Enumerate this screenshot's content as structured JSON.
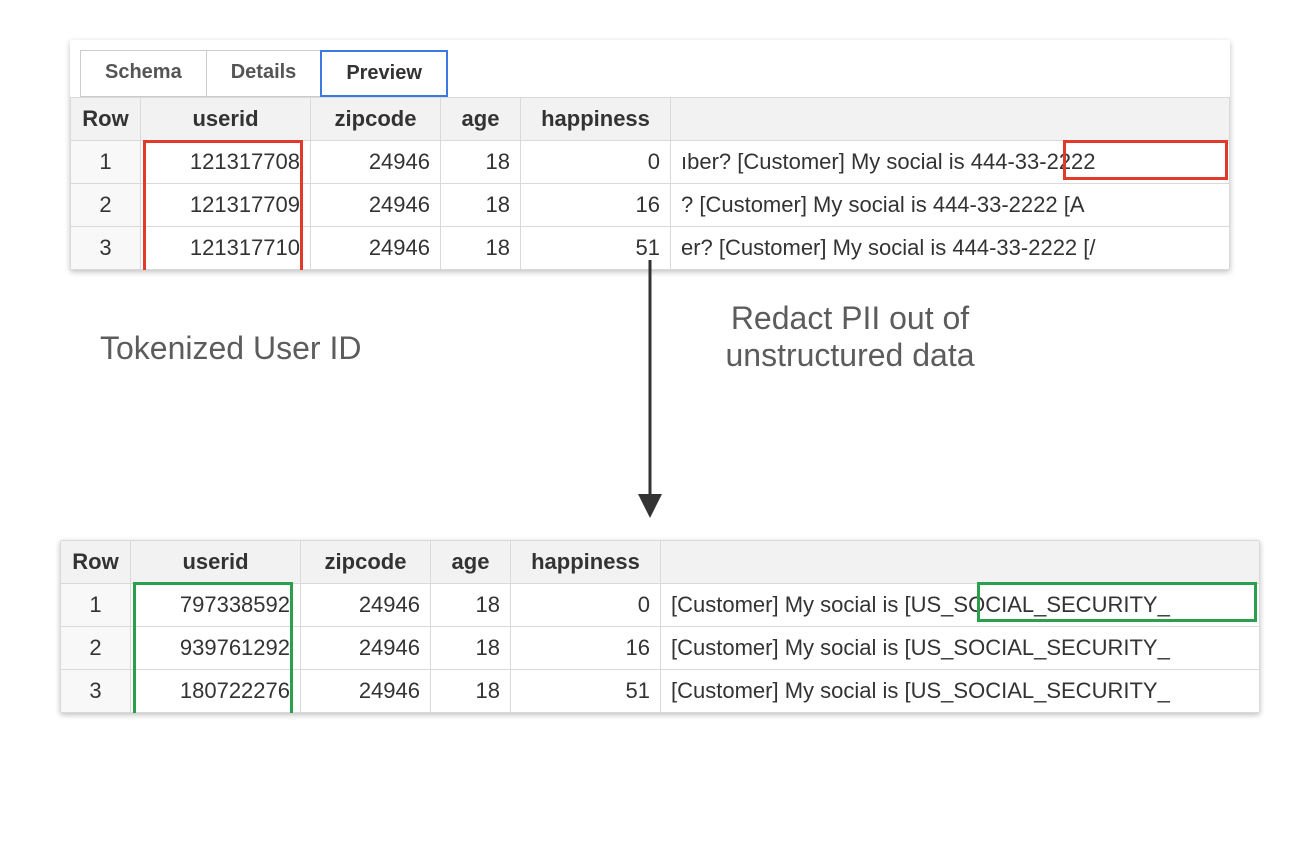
{
  "tabs": {
    "schema": "Schema",
    "details": "Details",
    "preview": "Preview"
  },
  "headers": {
    "row": "Row",
    "userid": "userid",
    "zipcode": "zipcode",
    "age": "age",
    "happiness": "happiness",
    "text": ""
  },
  "top_rows": [
    {
      "row": "1",
      "userid": "121317708",
      "zipcode": "24946",
      "age": "18",
      "happiness": "0",
      "text": "ıber? [Customer] My social is 444-33-2222"
    },
    {
      "row": "2",
      "userid": "121317709",
      "zipcode": "24946",
      "age": "18",
      "happiness": "16",
      "text": "? [Customer] My social is 444-33-2222 [A"
    },
    {
      "row": "3",
      "userid": "121317710",
      "zipcode": "24946",
      "age": "18",
      "happiness": "51",
      "text": "er? [Customer] My social is 444-33-2222 [/"
    }
  ],
  "bottom_rows": [
    {
      "row": "1",
      "userid": "797338592",
      "zipcode": "24946",
      "age": "18",
      "happiness": "0",
      "text": "[Customer] My social is [US_SOCIAL_SECURITY_"
    },
    {
      "row": "2",
      "userid": "939761292",
      "zipcode": "24946",
      "age": "18",
      "happiness": "16",
      "text": "[Customer] My social is [US_SOCIAL_SECURITY_"
    },
    {
      "row": "3",
      "userid": "180722276",
      "zipcode": "24946",
      "age": "18",
      "happiness": "51",
      "text": "[Customer] My social is [US_SOCIAL_SECURITY_"
    }
  ],
  "captions": {
    "left": "Tokenized User ID",
    "right": "Redact PII out of unstructured data"
  }
}
